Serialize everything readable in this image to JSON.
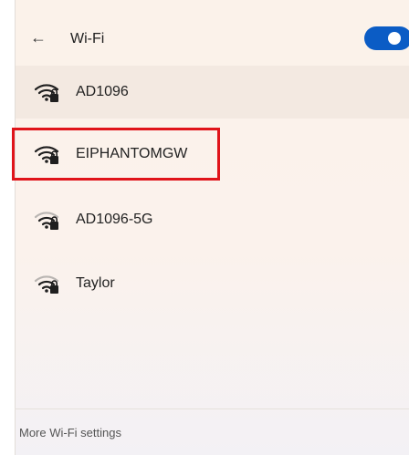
{
  "header": {
    "back_glyph": "←",
    "title": "Wi-Fi",
    "toggle_state": "on"
  },
  "networks": [
    {
      "name": "AD1096",
      "icon": "wifi-secured-icon",
      "signal": "strong",
      "secured": true
    },
    {
      "name": "EIPHANTOMGW",
      "icon": "wifi-secured-icon",
      "signal": "strong",
      "secured": true
    },
    {
      "name": "AD1096-5G",
      "icon": "wifi-secured-icon",
      "signal": "weak",
      "secured": true
    },
    {
      "name": "Taylor",
      "icon": "wifi-secured-icon",
      "signal": "weak",
      "secured": true
    }
  ],
  "footer": {
    "more_settings": "More Wi-Fi settings"
  },
  "colors": {
    "accent": "#0b5cc5",
    "highlight": "#e0141a"
  }
}
